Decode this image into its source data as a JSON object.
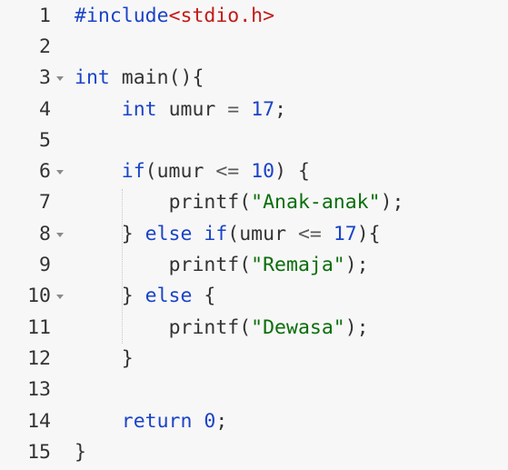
{
  "editor": {
    "lines": [
      {
        "num": "1",
        "foldable": false
      },
      {
        "num": "2",
        "foldable": false
      },
      {
        "num": "3",
        "foldable": true
      },
      {
        "num": "4",
        "foldable": false
      },
      {
        "num": "5",
        "foldable": false
      },
      {
        "num": "6",
        "foldable": true
      },
      {
        "num": "7",
        "foldable": false
      },
      {
        "num": "8",
        "foldable": true
      },
      {
        "num": "9",
        "foldable": false
      },
      {
        "num": "10",
        "foldable": true
      },
      {
        "num": "11",
        "foldable": false
      },
      {
        "num": "12",
        "foldable": false
      },
      {
        "num": "13",
        "foldable": false
      },
      {
        "num": "14",
        "foldable": false
      },
      {
        "num": "15",
        "foldable": false
      }
    ],
    "code": {
      "l1_a": "#include",
      "l1_b": "<stdio.h>",
      "l3_a": "int",
      "l3_b": " main(){",
      "l4_indent": "    ",
      "l4_a": "int",
      "l4_b": " umur ",
      "l4_c": "=",
      "l4_d": " ",
      "l4_e": "17",
      "l4_f": ";",
      "l6_indent": "    ",
      "l6_a": "if",
      "l6_b": "(umur ",
      "l6_c": "<=",
      "l6_d": " ",
      "l6_e": "10",
      "l6_f": ") {",
      "l7_indent": "        ",
      "l7_a": "printf(",
      "l7_b": "\"Anak-anak\"",
      "l7_c": ");",
      "l8_indent": "    ",
      "l8_a": "} ",
      "l8_b": "else",
      "l8_c": " ",
      "l8_d": "if",
      "l8_e": "(umur ",
      "l8_f": "<=",
      "l8_g": " ",
      "l8_h": "17",
      "l8_i": "){",
      "l9_indent": "        ",
      "l9_a": "printf(",
      "l9_b": "\"Remaja\"",
      "l9_c": ");",
      "l10_indent": "    ",
      "l10_a": "} ",
      "l10_b": "else",
      "l10_c": " {",
      "l11_indent": "        ",
      "l11_a": "printf(",
      "l11_b": "\"Dewasa\"",
      "l11_c": ");",
      "l12_indent": "    ",
      "l12_a": "}",
      "l14_indent": "    ",
      "l14_a": "return",
      "l14_b": " ",
      "l14_c": "0",
      "l14_d": ";",
      "l15_a": "}"
    }
  },
  "colors": {
    "background": "#f7f7f7",
    "keyword": "#1a43c8",
    "string": "#0b6e0b",
    "include": "#c41a16",
    "text": "#333333",
    "gutter_text": "#333333"
  },
  "icons": {
    "fold": "fold-arrow-icon"
  }
}
